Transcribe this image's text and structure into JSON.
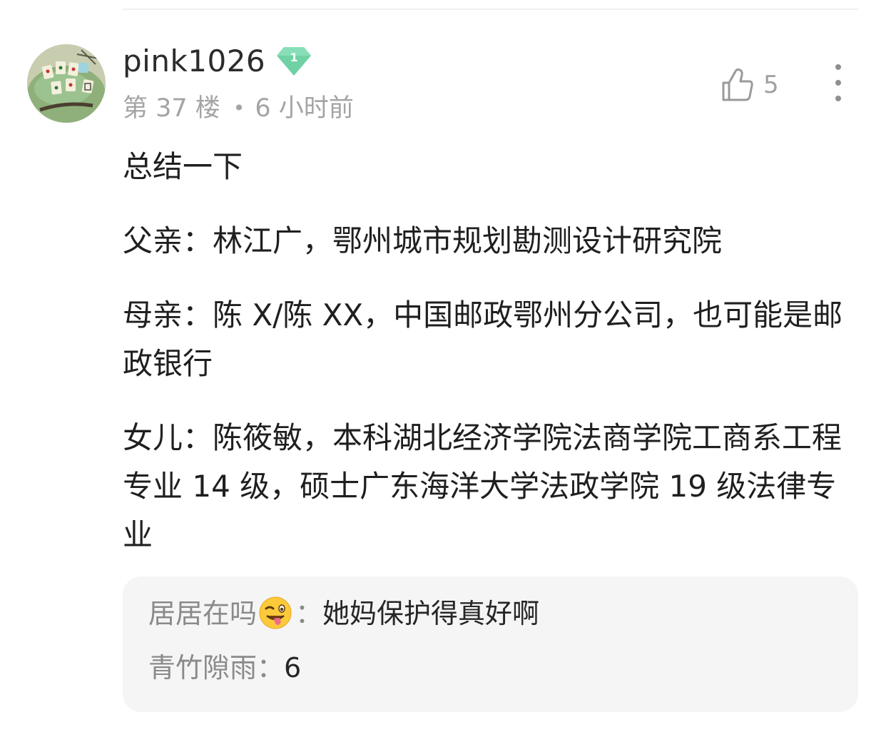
{
  "post": {
    "username": "pink1026",
    "level": "1",
    "floor": "第 37 楼",
    "separator": "•",
    "time": "6 小时前",
    "like_count": "5",
    "paragraphs": [
      "总结一下",
      "父亲：林江广，鄂州城市规划勘测设计研究院",
      "母亲：陈 X/陈 XX，中国邮政鄂州分公司，也可能是邮政银行",
      "女儿：陈筱敏，本科湖北经济学院法商学院工商系工程专业 14 级，硕士广东海洋大学法政学院 19 级法律专业"
    ]
  },
  "replies": [
    {
      "author": "居居在吗",
      "emoji": "winking-face-with-tongue",
      "colon": "：",
      "text": "她妈保护得真好啊"
    },
    {
      "author": "青竹隙雨",
      "colon": "：",
      "text": "6"
    }
  ],
  "colors": {
    "level_badge": "#6fd1a4",
    "meta_text": "#a4a4a4",
    "reply_box_bg": "#f5f5f5",
    "reply_author": "#8a8a8a"
  },
  "icons": {
    "avatar": "avatar-mahjong-cake",
    "level": "gem-level-badge-icon",
    "like": "thumbs-up-icon",
    "more": "more-vertical-icon"
  }
}
